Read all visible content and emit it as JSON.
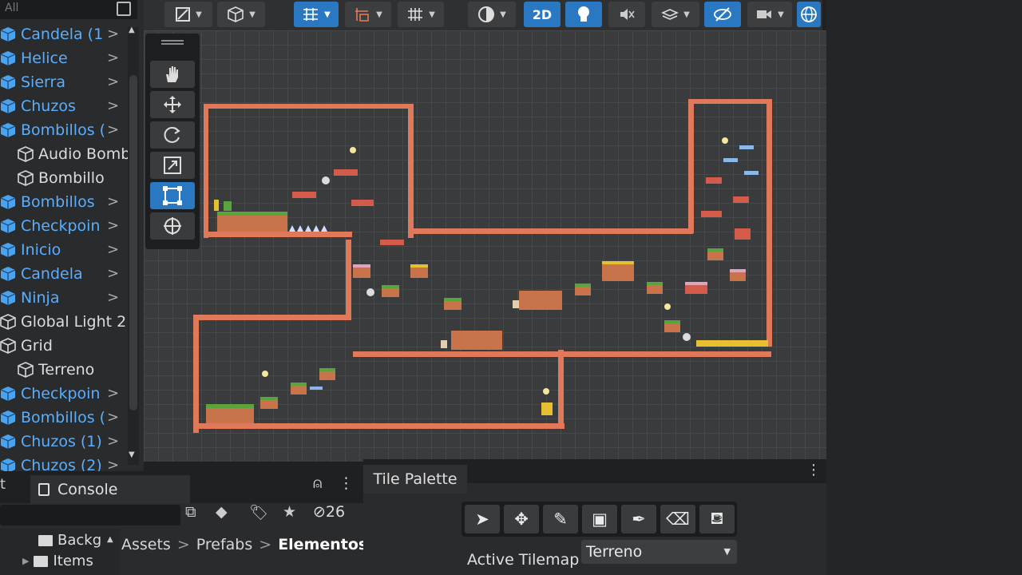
{
  "hierarchy": {
    "search_placeholder": "All",
    "items": [
      {
        "label": "Candela (1",
        "prefab": true,
        "indent": 0,
        "chevron": true
      },
      {
        "label": "Helice",
        "prefab": true,
        "indent": 0,
        "chevron": true
      },
      {
        "label": "Sierra",
        "prefab": true,
        "indent": 0,
        "chevron": true
      },
      {
        "label": "Chuzos",
        "prefab": true,
        "indent": 0,
        "chevron": true
      },
      {
        "label": "Bombillos (",
        "prefab": true,
        "indent": 0,
        "chevron": true
      },
      {
        "label": "Audio Bomb",
        "prefab": false,
        "indent": 1,
        "chevron": false
      },
      {
        "label": "Bombillo",
        "prefab": false,
        "indent": 1,
        "chevron": false
      },
      {
        "label": "Bombillos",
        "prefab": true,
        "indent": 0,
        "chevron": true
      },
      {
        "label": "Checkpoin",
        "prefab": true,
        "indent": 0,
        "chevron": true
      },
      {
        "label": "Inicio",
        "prefab": true,
        "indent": 0,
        "chevron": true
      },
      {
        "label": "Candela",
        "prefab": true,
        "indent": 0,
        "chevron": true
      },
      {
        "label": "Ninja",
        "prefab": true,
        "indent": 0,
        "chevron": true
      },
      {
        "label": "Global Light 2",
        "prefab": false,
        "indent": 0,
        "chevron": false
      },
      {
        "label": "Grid",
        "prefab": false,
        "indent": 0,
        "chevron": false
      },
      {
        "label": "Terreno",
        "prefab": false,
        "indent": 1,
        "chevron": false
      },
      {
        "label": "Checkpoin",
        "prefab": true,
        "indent": 0,
        "chevron": true
      },
      {
        "label": "Bombillos (",
        "prefab": true,
        "indent": 0,
        "chevron": true
      },
      {
        "label": "Chuzos (1)",
        "prefab": true,
        "indent": 0,
        "chevron": true
      },
      {
        "label": "Chuzos (2)",
        "prefab": true,
        "indent": 0,
        "chevron": true
      }
    ]
  },
  "toolbar": {
    "mode_2d": "2D"
  },
  "tools": [
    "hand-tool",
    "move-tool",
    "rotate-tool",
    "scale-tool",
    "rect-tool",
    "transform-tool"
  ],
  "bottom": {
    "tab_stub": "t",
    "console_tab": "Console",
    "hidden_count": "26",
    "folders": [
      "Backg",
      "Items"
    ],
    "breadcrumb": [
      "Assets",
      "Prefabs",
      "Elementos"
    ]
  },
  "tile_palette": {
    "tab": "Tile Palette",
    "tools": [
      "select-tool",
      "move-tool",
      "paint-brush-tool",
      "box-fill-tool",
      "pick-tool",
      "erase-tool",
      "fill-tool"
    ],
    "active_tilemap_label": "Active Tilemap",
    "active_tilemap_value": "Terreno"
  },
  "colors": {
    "accent": "#2b78c2",
    "prefab_text": "#5aaeff",
    "wall": "#e0785a",
    "platform_grass": "#5ba33b",
    "platform_dirt": "#c9734a"
  }
}
